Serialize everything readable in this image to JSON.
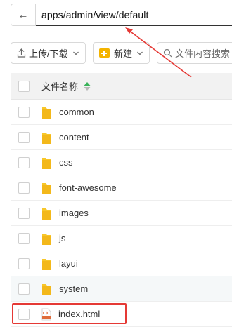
{
  "pathbar": {
    "back_icon": "arrow-left-icon",
    "path": "apps/admin/view/default"
  },
  "toolbar": {
    "upload_label": "上传/下载",
    "new_label": "新建",
    "search_placeholder": "文件内容搜索"
  },
  "table": {
    "header_name": "文件名称",
    "rows": [
      {
        "name": "common",
        "type": "folder"
      },
      {
        "name": "content",
        "type": "folder"
      },
      {
        "name": "css",
        "type": "folder"
      },
      {
        "name": "font-awesome",
        "type": "folder"
      },
      {
        "name": "images",
        "type": "folder"
      },
      {
        "name": "js",
        "type": "folder"
      },
      {
        "name": "layui",
        "type": "folder"
      },
      {
        "name": "system",
        "type": "folder"
      },
      {
        "name": "index.html",
        "type": "html-file"
      }
    ]
  },
  "colors": {
    "annotation": "#e53935",
    "folder": "#f8c72a",
    "sort_up": "#3bb35a"
  }
}
